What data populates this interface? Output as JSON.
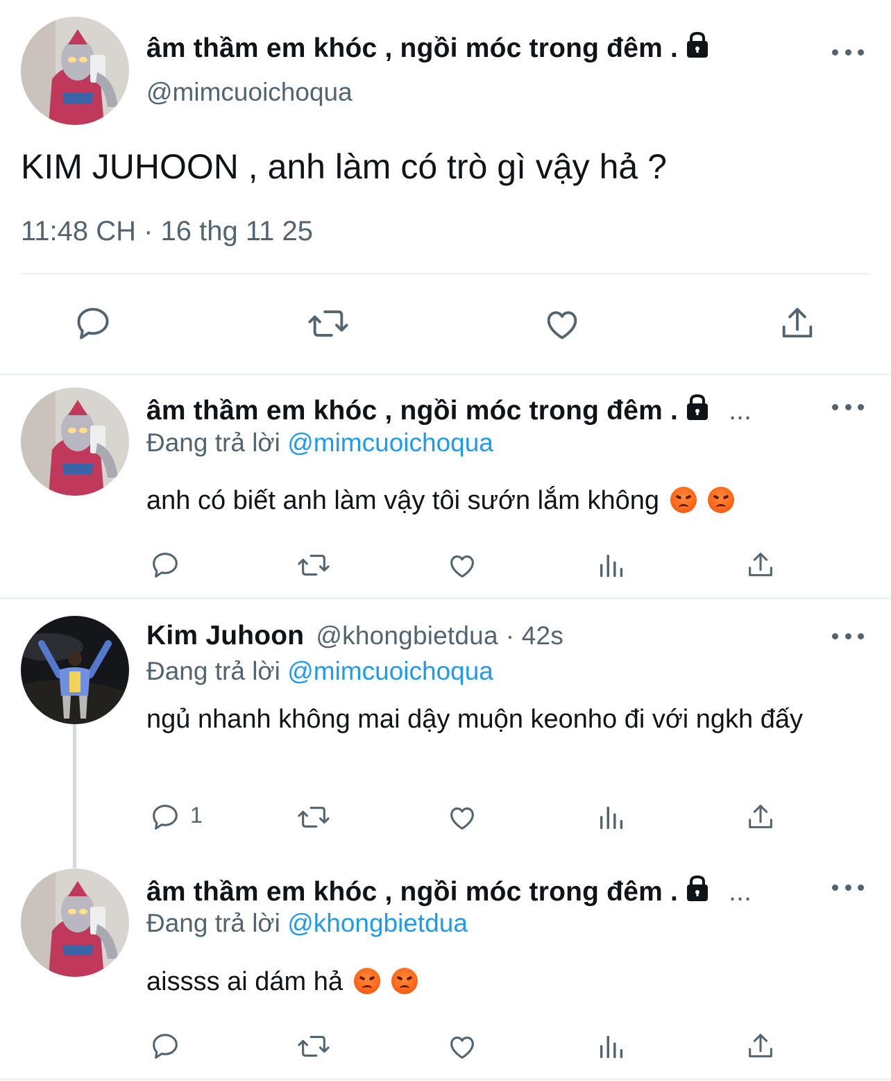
{
  "main_tweet": {
    "display_name": "âm thầm em khóc , ngồi móc trong đêm .",
    "handle": "@mimcuoichoqua",
    "text": "KIM JUHOON , anh làm có trò gì vậy hả ?",
    "timestamp": "11:48 CH · 16 thg 11 25",
    "actions": [
      "reply-icon",
      "retweet-icon",
      "like-icon",
      "share-icon"
    ]
  },
  "replies": [
    {
      "display_name": "âm thầm em khóc , ngồi móc trong đêm .",
      "truncation": "...",
      "replying_prefix": "Đang trả lời",
      "replying_to": "@mimcuoichoqua",
      "text": "anh có biết anh làm vậy tôi sướn lắm không",
      "emoji": "angry-face",
      "reply_count": ""
    },
    {
      "display_name": "Kim Juhoon",
      "handle": "@khongbietdua",
      "time": "· 42s",
      "replying_prefix": "Đang trả lời",
      "replying_to": "@mimcuoichoqua",
      "text": "ngủ nhanh không mai dậy muộn keonho đi với ngkh đấy",
      "reply_count": "1"
    },
    {
      "display_name": "âm thầm em khóc , ngồi móc trong đêm .",
      "truncation": "...",
      "replying_prefix": "Đang trả lời",
      "replying_to": "@khongbietdua",
      "text": "aissss ai dám hả",
      "emoji": "angry-face",
      "reply_count": ""
    }
  ],
  "colors": {
    "text": "#0f1419",
    "muted": "#536471",
    "link": "#1d9bf0",
    "divider": "#eff3f4"
  }
}
